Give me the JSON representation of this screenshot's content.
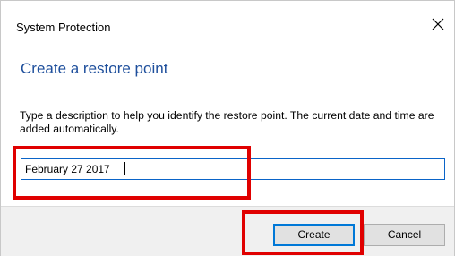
{
  "window": {
    "title": "System Protection",
    "close_icon": "close-icon"
  },
  "content": {
    "heading": "Create a restore point",
    "description": "Type a description to help you identify the restore point. The current date and time are added automatically.",
    "description_input": {
      "value": "February 27 2017",
      "placeholder": ""
    }
  },
  "footer": {
    "create_label": "Create",
    "cancel_label": "Cancel"
  },
  "colors": {
    "heading": "#1e4f9c",
    "focus_border": "#0078d7",
    "highlight": "#e00000",
    "footer_bg": "#f0f0f0"
  },
  "annotations": {
    "highlights": [
      "description-input",
      "create-button"
    ]
  }
}
